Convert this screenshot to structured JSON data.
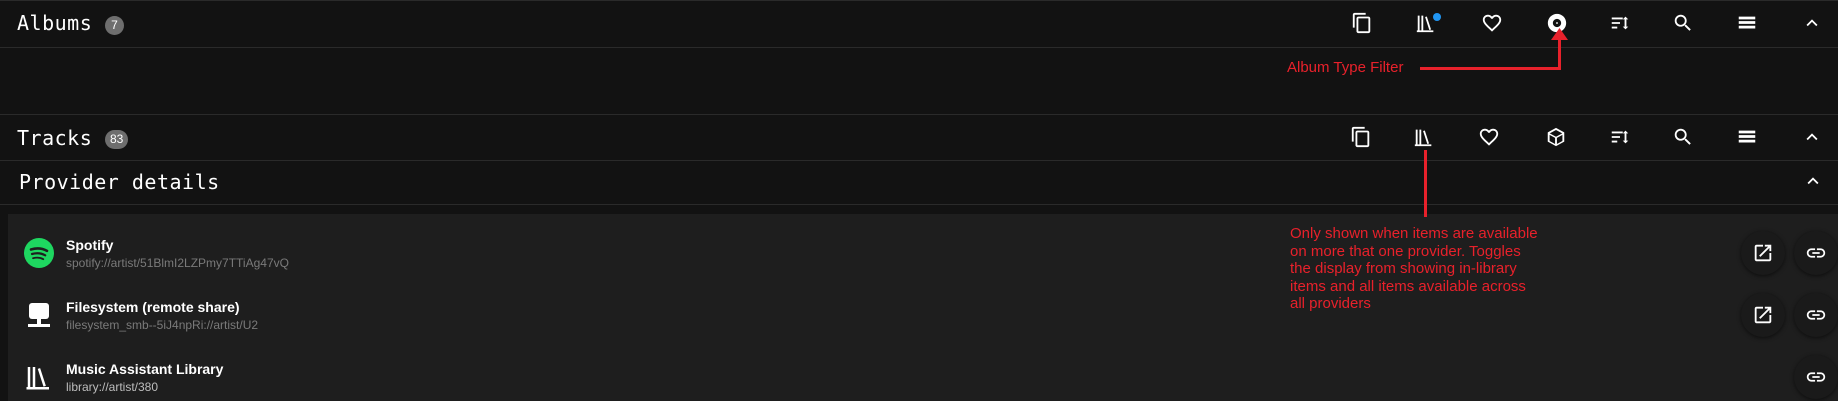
{
  "albums": {
    "title": "Albums",
    "count": "7",
    "toolbar": [
      "copy-icon",
      "library-icon",
      "heart-icon",
      "album-type-filter-icon",
      "sort-icon",
      "search-icon",
      "list-view-icon",
      "chevron-up-icon"
    ]
  },
  "tracks": {
    "title": "Tracks",
    "count": "83",
    "toolbar": [
      "copy-icon",
      "library-icon",
      "heart-icon",
      "box-icon",
      "sort-icon",
      "search-icon",
      "list-view-icon",
      "chevron-up-icon"
    ]
  },
  "provider_details": {
    "title": "Provider details",
    "providers": [
      {
        "name": "Spotify",
        "uri": "spotify://artist/51BlmI2LZPmy7TTiAg47vQ",
        "icon": "spotify-icon"
      },
      {
        "name": "Filesystem (remote share)",
        "uri": "filesystem_smb--5iJ4npRi://artist/U2",
        "icon": "filesystem-icon"
      },
      {
        "name": "Music Assistant Library",
        "uri": "library://artist/380",
        "icon": "library-icon"
      }
    ]
  },
  "annotations": {
    "album_type_filter": "Album Type Filter",
    "library_toggle": [
      "Only shown when items are available",
      "on more that one provider. Toggles",
      "the display from showing in-library",
      "items and all items available across",
      "all providers"
    ]
  },
  "colors": {
    "background": "#121212",
    "panel": "#1e1e1e",
    "annotation": "#e8212b",
    "badge": "#6e6e6e",
    "spotify": "#1ed760",
    "notification_dot": "#2196f3"
  }
}
